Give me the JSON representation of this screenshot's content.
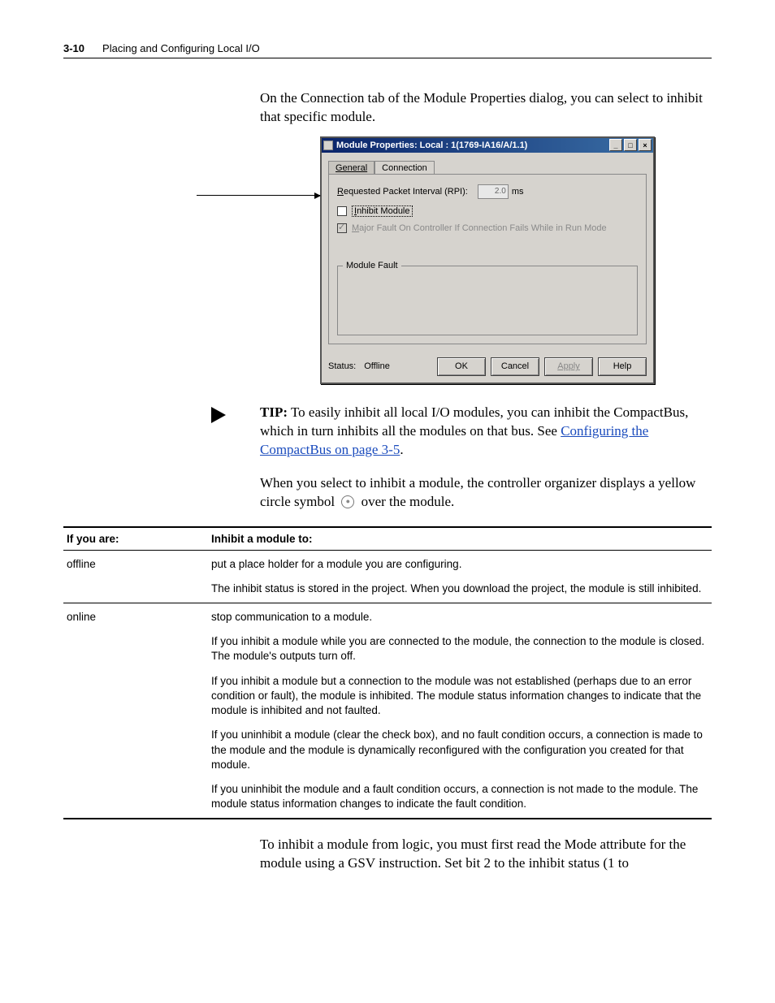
{
  "header": {
    "pageNum": "3-10",
    "section": "Placing and Configuring Local I/O"
  },
  "intro": "On the Connection tab of the Module Properties dialog, you can select to inhibit that specific module.",
  "dialog": {
    "title": "Module Properties: Local : 1(1769-IA16/A/1.1)",
    "tabs": {
      "general": "General",
      "connection": "Connection"
    },
    "rpi": {
      "labelPrefix": "R",
      "labelRest": "equested Packet Interval (RPI):",
      "value": "2.0",
      "unit": "ms"
    },
    "inhibit": {
      "prefix": "I",
      "rest": "nhibit Module"
    },
    "majorFault": {
      "prefix": "M",
      "rest": "ajor Fault On Controller If Connection Fails While in Run Mode"
    },
    "moduleFault": "Module Fault",
    "statusLabel": "Status:",
    "statusValue": "Offline",
    "buttons": {
      "ok": "OK",
      "cancel": "Cancel",
      "apply": "Apply",
      "help": "Help"
    }
  },
  "tip": {
    "label": "TIP:",
    "text1": "To easily inhibit all local I/O modules, you can inhibit the CompactBus, which in turn inhibits all the modules on that bus. See ",
    "link": "Configuring the CompactBus on page 3-5",
    "text2": "."
  },
  "afterTip": {
    "p1a": "When you select to inhibit a module, the controller organizer displays a yellow circle symbol ",
    "p1b": " over the module."
  },
  "table": {
    "h1": "If you are:",
    "h2": "Inhibit a module to:",
    "rows": [
      {
        "c1": "offline",
        "c2": [
          "put a place holder for a module you are configuring.",
          "The inhibit status is stored in the project. When you download the project, the module is still inhibited."
        ]
      },
      {
        "c1": "online",
        "c2": [
          "stop communication to a module.",
          "If you inhibit a module while you are connected to the module, the connection to the module is closed. The module's outputs turn off.",
          "If you inhibit a module but a connection to the module was not established (perhaps due to an error condition or fault), the module is inhibited. The module status information changes to indicate that the module is inhibited and not faulted.",
          "If you uninhibit a module (clear the check box), and no fault condition occurs, a connection is made to the module and the module is dynamically reconfigured with the configuration you created for that module.",
          "If you uninhibit the module and a fault condition occurs, a connection is not made to the module. The module status information changes to indicate the fault condition."
        ]
      }
    ]
  },
  "closing": "To inhibit a module from logic, you must first read the Mode attribute for the module using a GSV instruction. Set bit 2 to the inhibit status (1 to"
}
